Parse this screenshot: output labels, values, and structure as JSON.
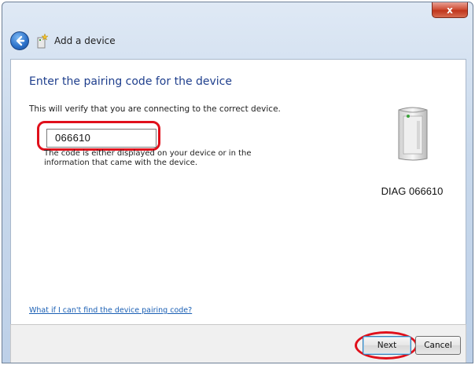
{
  "window": {
    "close_label": "x"
  },
  "header": {
    "title": "Add a device"
  },
  "main": {
    "heading": "Enter the pairing code for the device",
    "description": "This will verify that you are connecting to the correct device.",
    "pairing_code": "066610",
    "help_text": "The code is either displayed on your device or in the information that came with the device.",
    "device_name": "DIAG 066610",
    "help_link": "What if I can't find the device pairing code?"
  },
  "footer": {
    "next_label": "Next",
    "cancel_label": "Cancel"
  },
  "colors": {
    "accent_title": "#1f3f8d",
    "highlight": "#e0101b",
    "link": "#1a5fb4"
  }
}
